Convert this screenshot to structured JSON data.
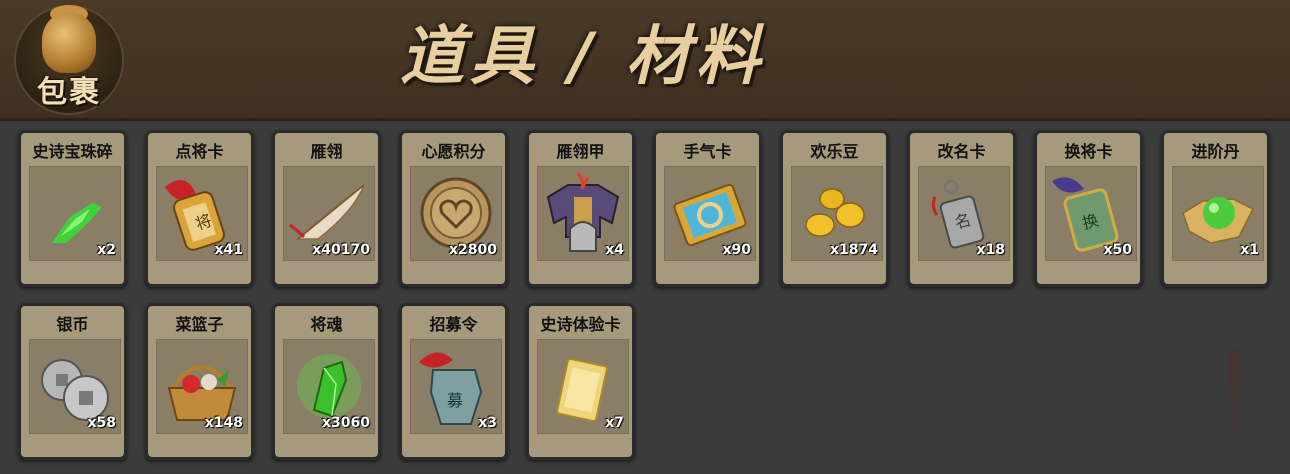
{
  "header": {
    "bag_label": "包裹",
    "title": "道具 / 材料"
  },
  "items": [
    {
      "name": "史诗宝珠碎",
      "qty": "x2",
      "icon": "green-shard-icon"
    },
    {
      "name": "点将卡",
      "qty": "x41",
      "icon": "general-card-icon"
    },
    {
      "name": "雁翎",
      "qty": "x40170",
      "icon": "feather-icon"
    },
    {
      "name": "心愿积分",
      "qty": "x2800",
      "icon": "heart-coin-icon"
    },
    {
      "name": "雁翎甲",
      "qty": "x4",
      "icon": "armor-icon"
    },
    {
      "name": "手气卡",
      "qty": "x90",
      "icon": "luck-card-icon"
    },
    {
      "name": "欢乐豆",
      "qty": "x1874",
      "icon": "gold-beans-icon"
    },
    {
      "name": "改名卡",
      "qty": "x18",
      "icon": "rename-card-icon"
    },
    {
      "name": "换将卡",
      "qty": "x50",
      "icon": "swap-general-card-icon"
    },
    {
      "name": "进阶丹",
      "qty": "x1",
      "icon": "green-pill-icon"
    },
    {
      "name": "银币",
      "qty": "x58",
      "icon": "silver-coin-icon"
    },
    {
      "name": "菜篮子",
      "qty": "x148",
      "icon": "basket-icon"
    },
    {
      "name": "将魂",
      "qty": "x3060",
      "icon": "soul-crystal-icon"
    },
    {
      "name": "招募令",
      "qty": "x3",
      "icon": "recruit-token-icon"
    },
    {
      "name": "史诗体验卡",
      "qty": "x7",
      "icon": "epic-trial-card-icon"
    }
  ]
}
